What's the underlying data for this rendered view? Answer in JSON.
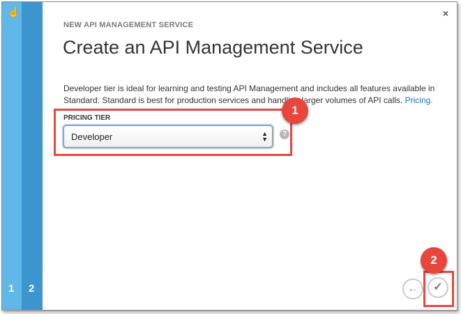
{
  "wizard": {
    "steps": [
      "1",
      "2"
    ],
    "eyebrow": "NEW API MANAGEMENT SERVICE",
    "title": "Create an API Management Service",
    "description": "Developer tier is ideal for learning and testing API Management and includes all features available in Standard. Standard is best for production services and handling larger volumes of API calls.",
    "pricing_link": "Pricing.",
    "pricing_tier_label": "PRICING TIER",
    "pricing_tier_value": "Developer",
    "help_glyph": "?",
    "close_glyph": "×"
  },
  "callouts": [
    "1",
    "2"
  ],
  "footer": {
    "back_icon": "arrow-left-icon",
    "ok_icon": "checkmark-icon"
  },
  "colors": {
    "rail_light": "#5fb8e8",
    "rail_dark": "#3d95cf",
    "annotation_red": "#e8453c",
    "link_blue": "#1a73b8"
  }
}
